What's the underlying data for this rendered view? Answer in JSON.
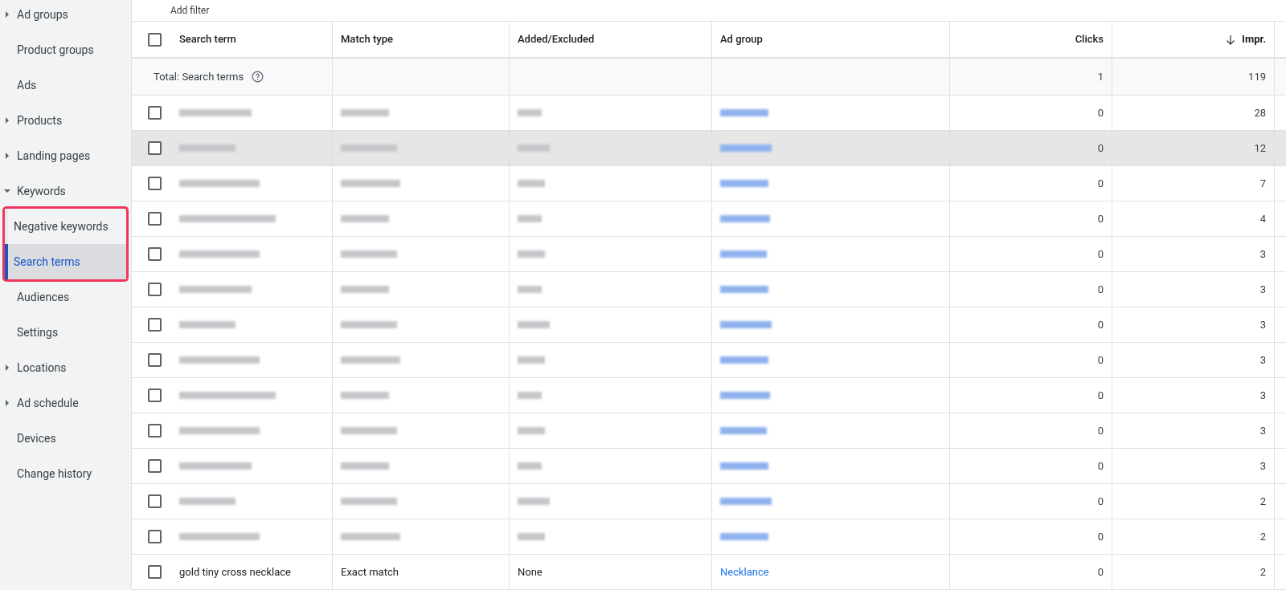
{
  "toolbar": {
    "filter_label": "Add filter"
  },
  "sidebar": {
    "items": [
      {
        "label": "Ad groups",
        "kind": "group",
        "expanded": false,
        "selected": false
      },
      {
        "label": "Product groups",
        "kind": "link",
        "selected": false
      },
      {
        "label": "Ads",
        "kind": "link",
        "selected": false
      },
      {
        "label": "Products",
        "kind": "group",
        "expanded": false,
        "selected": false
      },
      {
        "label": "Landing pages",
        "kind": "group",
        "expanded": false,
        "selected": false
      },
      {
        "label": "Keywords",
        "kind": "group",
        "expanded": true,
        "selected": false,
        "children": [
          {
            "label": "Negative keywords",
            "selected": false,
            "annotated": true
          },
          {
            "label": "Search terms",
            "selected": true,
            "annotated": true
          }
        ]
      },
      {
        "label": "Audiences",
        "kind": "link",
        "selected": false
      },
      {
        "label": "Settings",
        "kind": "link",
        "selected": false
      },
      {
        "label": "Locations",
        "kind": "group",
        "expanded": false,
        "selected": false
      },
      {
        "label": "Ad schedule",
        "kind": "group",
        "expanded": false,
        "selected": false
      },
      {
        "label": "Devices",
        "kind": "link",
        "selected": false
      },
      {
        "label": "Change history",
        "kind": "link",
        "selected": false
      }
    ]
  },
  "table": {
    "columns": [
      {
        "label": "Search term",
        "kind": "text",
        "sorted": false
      },
      {
        "label": "Match type",
        "kind": "text",
        "sorted": false
      },
      {
        "label": "Added/Excluded",
        "kind": "text",
        "sorted": false
      },
      {
        "label": "Ad group",
        "kind": "text",
        "sorted": false
      },
      {
        "label": "Clicks",
        "kind": "number",
        "sorted": false
      },
      {
        "label": "Impr.",
        "kind": "number",
        "sorted": true
      }
    ],
    "total": {
      "label": "Total: Search terms",
      "clicks": "1",
      "impr": "119"
    },
    "rows": [
      {
        "redacted": true,
        "highlighted": false,
        "checked": false,
        "clicks": "0",
        "impr": "28"
      },
      {
        "redacted": true,
        "highlighted": true,
        "checked": false,
        "clicks": "0",
        "impr": "12"
      },
      {
        "redacted": true,
        "highlighted": false,
        "checked": false,
        "clicks": "0",
        "impr": "7"
      },
      {
        "redacted": true,
        "highlighted": false,
        "checked": false,
        "clicks": "0",
        "impr": "4"
      },
      {
        "redacted": true,
        "highlighted": false,
        "checked": false,
        "clicks": "0",
        "impr": "3"
      },
      {
        "redacted": true,
        "highlighted": false,
        "checked": false,
        "clicks": "0",
        "impr": "3"
      },
      {
        "redacted": true,
        "highlighted": false,
        "checked": false,
        "clicks": "0",
        "impr": "3"
      },
      {
        "redacted": true,
        "highlighted": false,
        "checked": false,
        "clicks": "0",
        "impr": "3"
      },
      {
        "redacted": true,
        "highlighted": false,
        "checked": false,
        "clicks": "0",
        "impr": "3"
      },
      {
        "redacted": true,
        "highlighted": false,
        "checked": false,
        "clicks": "0",
        "impr": "3"
      },
      {
        "redacted": true,
        "highlighted": false,
        "checked": false,
        "clicks": "0",
        "impr": "3"
      },
      {
        "redacted": true,
        "highlighted": false,
        "checked": false,
        "clicks": "0",
        "impr": "2"
      },
      {
        "redacted": true,
        "highlighted": false,
        "checked": false,
        "clicks": "0",
        "impr": "2"
      },
      {
        "redacted": false,
        "highlighted": false,
        "checked": false,
        "search_term": "gold tiny cross necklace",
        "match_type": "Exact match",
        "added_excluded": "None",
        "ad_group": "Necklance",
        "clicks": "0",
        "impr": "2"
      }
    ]
  }
}
